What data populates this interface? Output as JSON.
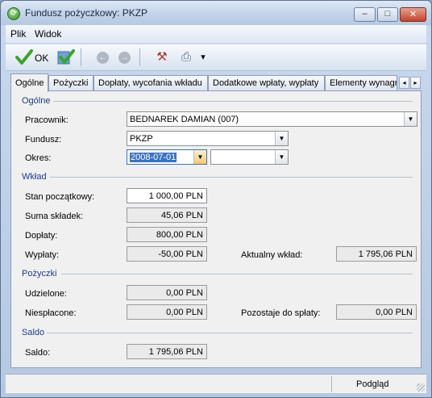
{
  "window": {
    "title": "Fundusz pożyczkowy: PKZP",
    "app_icon_glyph": "⟳",
    "controls": {
      "minimize": "–",
      "maximize": "□",
      "close": "✕"
    }
  },
  "menu": {
    "items": [
      "Plik",
      "Widok"
    ]
  },
  "toolbar": {
    "ok_label": "OK",
    "icons": [
      "ok-check-icon",
      "save-check-icon",
      "back-icon",
      "forward-icon",
      "tools-icon",
      "printer-icon",
      "dropdown-arrow-icon"
    ],
    "back_glyph": "←",
    "forward_glyph": "→",
    "tools_glyph": "⚒",
    "printer_glyph": "⎙",
    "dropdown_glyph": "▾"
  },
  "tabs": {
    "items": [
      "Ogólne",
      "Pożyczki",
      "Dopłaty, wycofania wkładu",
      "Dodatkowe wpłaty, wypłaty",
      "Elementy wynagrod"
    ],
    "active": "Ogólne",
    "scroll_left": "◂",
    "scroll_right": "▸"
  },
  "sections": {
    "ogolne": "Ogólne",
    "wklad": "Wkład",
    "pozyczki": "Pożyczki",
    "saldo": "Saldo"
  },
  "ogolne": {
    "pracownik_label": "Pracownik:",
    "pracownik_value": "BEDNAREK DAMIAN (007)",
    "fundusz_label": "Fundusz:",
    "fundusz_value": "PKZP",
    "okres_label": "Okres:",
    "okres_from": "2008-07-01",
    "okres_to": "",
    "dropdown_glyph": "▼"
  },
  "wklad": {
    "stan_label": "Stan początkowy:",
    "stan_value": "1 000,00 PLN",
    "suma_label": "Suma składek:",
    "suma_value": "45,06 PLN",
    "doplaty_label": "Dopłaty:",
    "doplaty_value": "800,00 PLN",
    "wyplaty_label": "Wypłaty:",
    "wyplaty_value": "-50,00 PLN",
    "aktualny_label": "Aktualny wkład:",
    "aktualny_value": "1 795,06 PLN"
  },
  "pozyczki": {
    "udzielone_label": "Udzielone:",
    "udzielone_value": "0,00 PLN",
    "niesplacone_label": "Niespłacone:",
    "niesplacone_value": "0,00 PLN",
    "pozostaje_label": "Pozostaje do spłaty:",
    "pozostaje_value": "0,00 PLN"
  },
  "saldo": {
    "saldo_label": "Saldo:",
    "saldo_value": "1 795,06 PLN"
  },
  "status": {
    "text": "Podgląd"
  },
  "colors": {
    "section_title": "#1b3a8a",
    "selection": "#3a72c4",
    "ok_green": "#3aa52a"
  }
}
